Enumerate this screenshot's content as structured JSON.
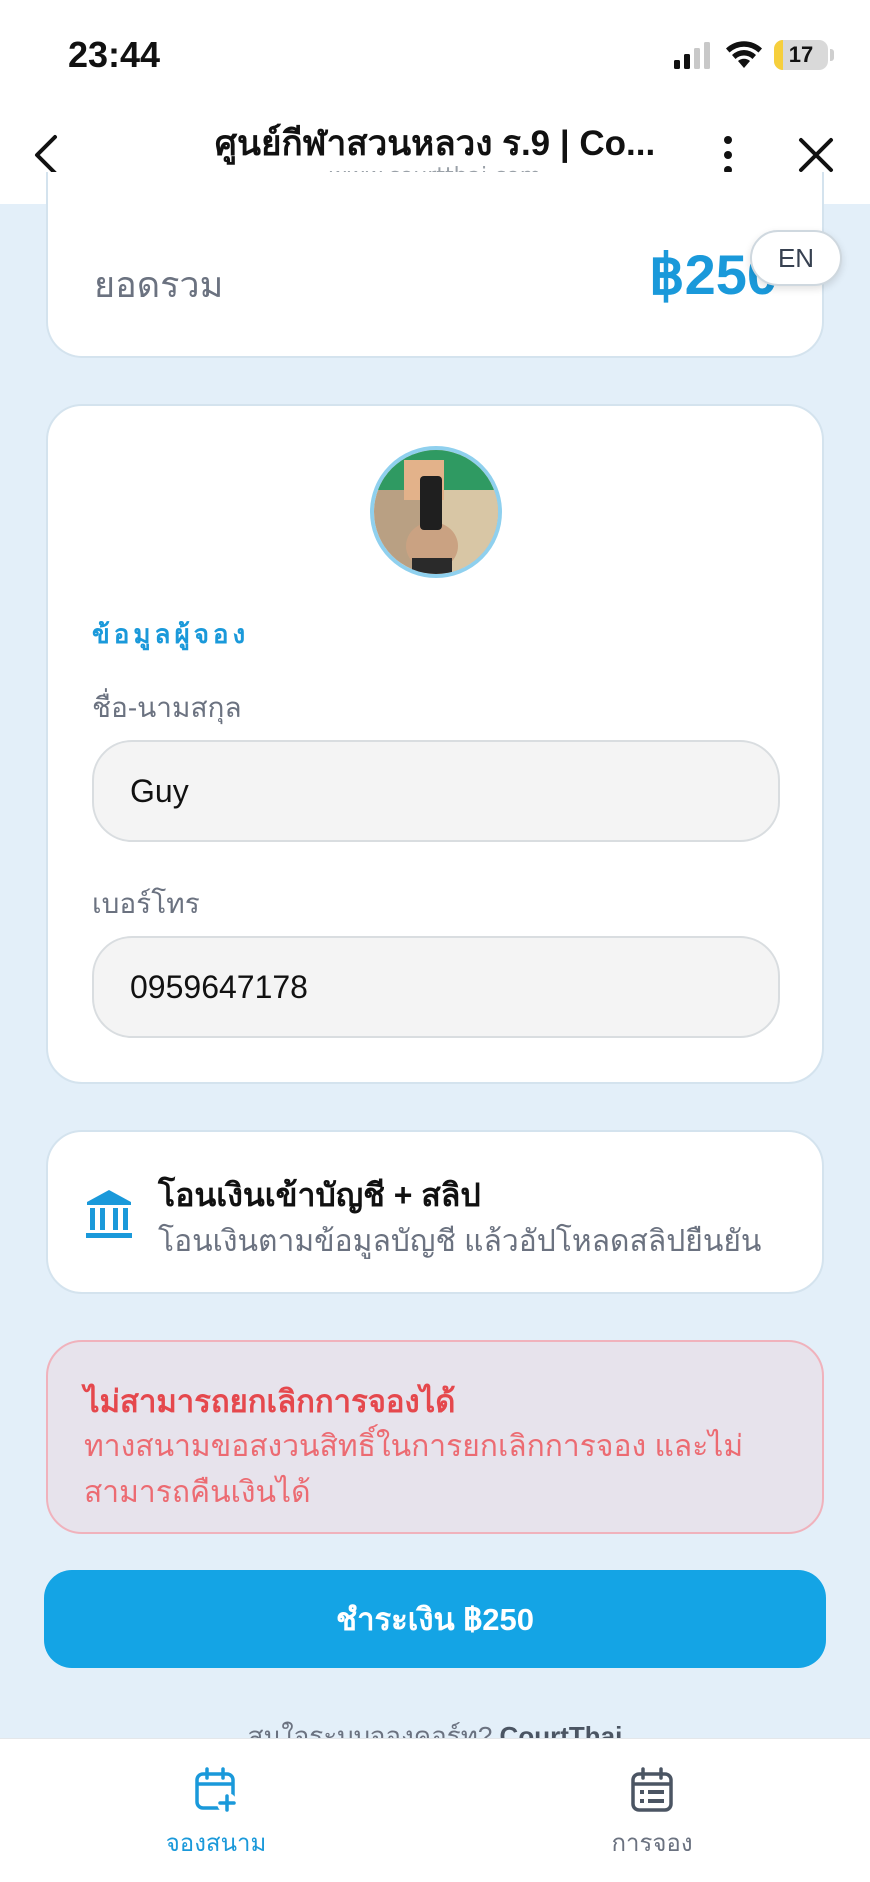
{
  "status_bar": {
    "time": "23:44",
    "battery_level": "17",
    "battery_fraction": 0.17
  },
  "browser": {
    "title": "ศูนย์กีฬาสวนหลวง ร.9 | Co...",
    "url": "www.courtthai.com"
  },
  "language_toggle": "EN",
  "summary": {
    "total_label": "ยอดรวม",
    "total_amount": "฿250"
  },
  "booker": {
    "section_heading": "ข้อมูลผู้จอง",
    "name_label": "ชื่อ-นามสกุล",
    "name_value": "Guy",
    "phone_label": "เบอร์โทร",
    "phone_value": "0959647178"
  },
  "payment_method": {
    "icon": "bank-icon",
    "title": "โอนเงินเข้าบัญชี + สลิป",
    "description": "โอนเงินตามข้อมูลบัญชี แล้วอัปโหลดสลิปยืนยัน"
  },
  "warning": {
    "title": "ไม่สามารถยกเลิกการจองได้",
    "body": "ทางสนามขอสงวนสิทธิ์ในการยกเลิกการจอง และไม่สามารถคืนเงินได้"
  },
  "pay_button": "ชำระเงิน ฿250",
  "footer": {
    "text": "สนใจระบบจองคอร์ท?",
    "brand": "CourtThai"
  },
  "bottom_nav": [
    {
      "label": "จองสนาม",
      "icon": "calendar-plus-icon",
      "active": true
    },
    {
      "label": "การจอง",
      "icon": "calendar-list-icon",
      "active": false
    }
  ],
  "colors": {
    "accent": "#1a99da",
    "button": "#14a4e5",
    "warning_text": "#e5484d",
    "warning_bg": "#e7e3ec"
  }
}
